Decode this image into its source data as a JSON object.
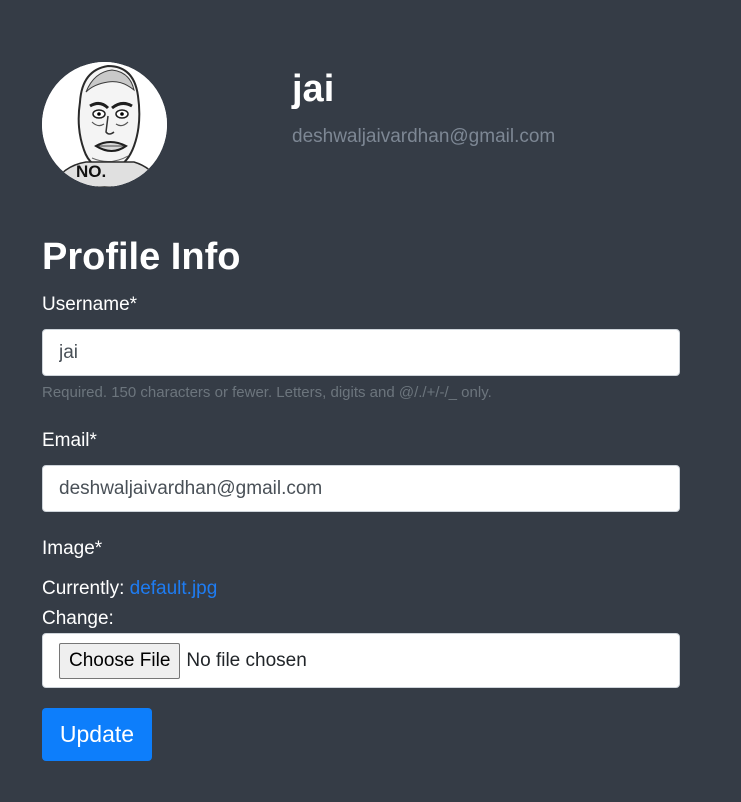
{
  "profile": {
    "name": "jai",
    "email": "deshwaljaivardhan@gmail.com",
    "avatar_icon": "meme-face-icon",
    "avatar_caption": "NO."
  },
  "form": {
    "title": "Profile Info",
    "username": {
      "label": "Username*",
      "value": "jai",
      "help": "Required. 150 characters or fewer. Letters, digits and @/./+/-/_ only."
    },
    "email": {
      "label": "Email*",
      "value": "deshwaljaivardhan@gmail.com"
    },
    "image": {
      "label": "Image*",
      "currently_label": "Currently:",
      "current_file": "default.jpg",
      "change_label": "Change:",
      "choose_button": "Choose File",
      "file_status": "No file chosen"
    },
    "submit_label": "Update"
  },
  "colors": {
    "background": "#353c46",
    "accent": "#0d7efb",
    "link": "#1e7cf2",
    "muted_text": "#7d8794"
  }
}
